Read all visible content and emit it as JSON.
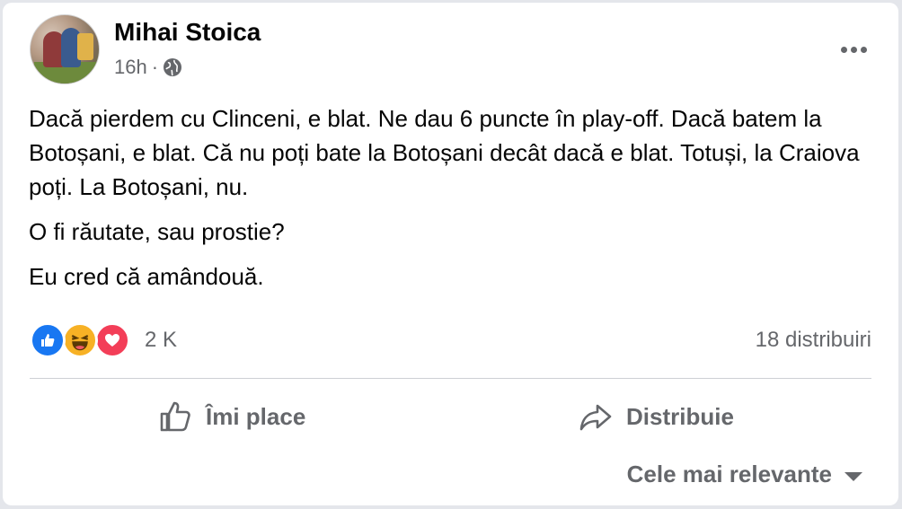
{
  "post": {
    "author": "Mihai Stoica",
    "time": "16h",
    "separator": "·",
    "privacy_icon": "globe-icon",
    "more_icon": "more-options-icon",
    "paragraphs": [
      "Dacă pierdem cu Clinceni, e blat. Ne dau 6 puncte în play-off. Dacă batem la Botoșani, e blat. Că nu poți bate la Botoșani decât dacă e blat. Totuși, la Craiova poți. La Botoșani, nu.",
      "O fi răutate, sau prostie?",
      "Eu cred că amândouă."
    ]
  },
  "reactions": {
    "icons": [
      "like-reaction-icon",
      "haha-reaction-icon",
      "love-reaction-icon"
    ],
    "count": "2 K",
    "shares": "18 distribuiri"
  },
  "actions": {
    "like_label": "Îmi place",
    "share_label": "Distribuie"
  },
  "comments": {
    "sort_label": "Cele mai relevante",
    "sort_icon": "caret-down-icon"
  },
  "colors": {
    "like_blue": "#1877f2",
    "haha_yellow": "#f7b125",
    "love_red": "#f33e58",
    "secondary_text": "#65676b"
  }
}
